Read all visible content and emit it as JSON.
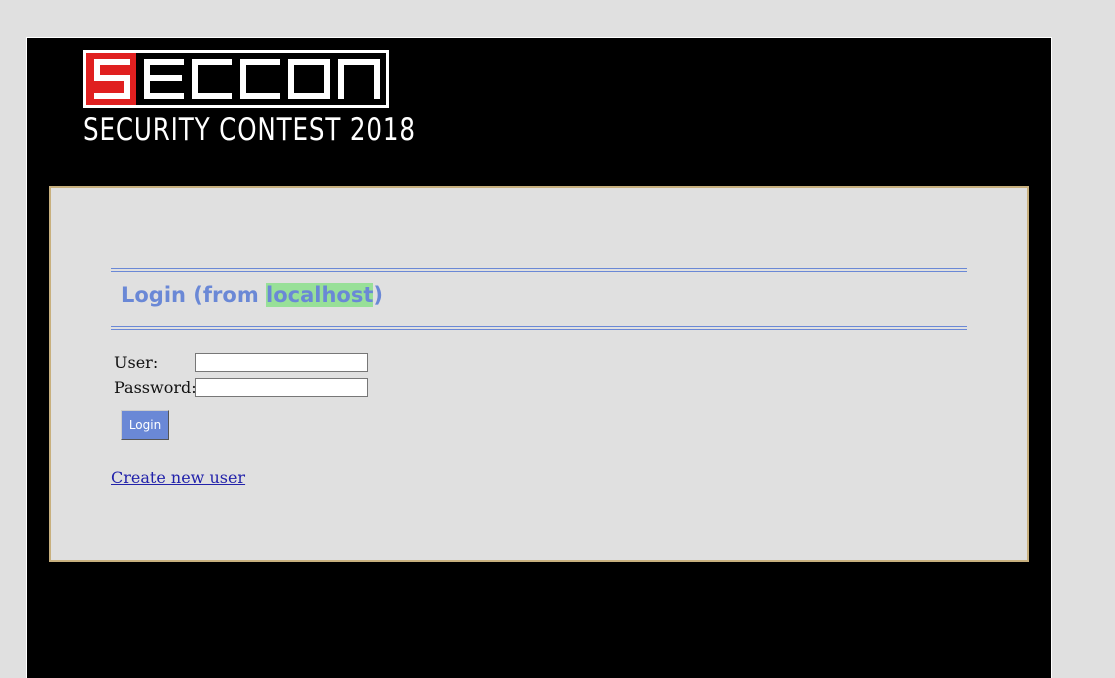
{
  "logo": {
    "mark_text": "SECCON",
    "subtitle": "SECURITY CONTEST 2018",
    "accent_color": "#e02020"
  },
  "login": {
    "title_prefix": "Login (from ",
    "title_host": "localhost",
    "title_suffix": ")",
    "user_label": "User:",
    "user_value": "",
    "password_label": "Password:",
    "password_value": "",
    "submit_label": "Login",
    "create_user_link": "Create new user"
  },
  "colors": {
    "title": "#6a88d6",
    "host_highlight": "#98e098",
    "panel_border": "#c8b07e",
    "link": "#2222aa"
  }
}
